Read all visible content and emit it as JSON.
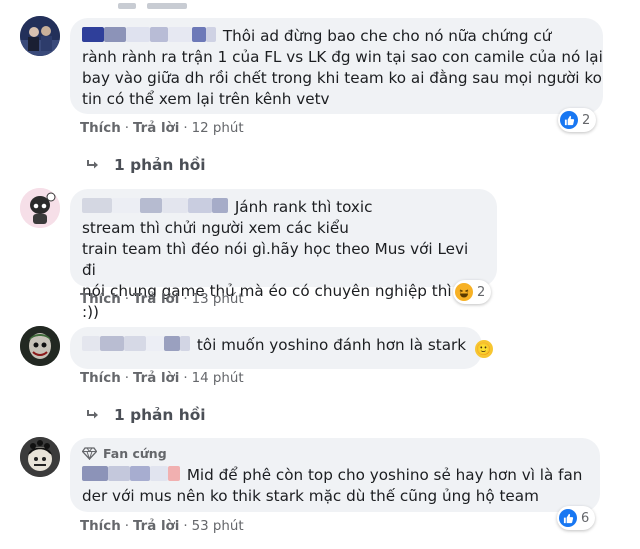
{
  "comments": [
    {
      "text": "Thôi ad đừng bao che cho nó nữa chứng cứ rành rành ra trận 1 của FL vs LK đg win tại sao con camile của nó lại bay vào giữa dh rồi chết trong khi team ko ai đằng sau mọi người ko tin có thể xem lại trên kênh vetv",
      "line1": "Thôi ad đừng bao che cho nó nữa chứng cứ",
      "line2": "rành rành ra trận 1 của FL vs LK đg win tại sao con camile của nó lại",
      "line3": "bay vào giữa dh rồi chết trong khi team ko ai đằng sau mọi người ko",
      "line4": "tin có thể xem lại trên kênh vetv",
      "like": "Thích",
      "reply": "Trả lời",
      "time": "12 phút",
      "reaction_icon": "like-icon",
      "reaction_count": "2"
    },
    {
      "line1": "Jánh rank thì toxic",
      "line2": "stream thì chửi người xem các kiểu",
      "line3": "train team thì đéo nói gì.hãy học theo Mus với Levi đi",
      "line4": "nói chung game thủ mà éo có chuyên nghiệp thì vứt :))",
      "like": "Thích",
      "reply": "Trả lời",
      "time": "13 phút",
      "reaction_icon": "haha-icon",
      "reaction_count": "2"
    },
    {
      "line1": "tôi muốn yoshino đánh hơn là stark",
      "emoji": "🙂",
      "like": "Thích",
      "reply": "Trả lời",
      "time": "14 phút"
    },
    {
      "badge": "Fan cứng",
      "line1": "Mid để phê còn top cho yoshino sẻ hay hơn vì là fan",
      "line2": "der với mus nên ko thik stark mặc dù thế cũng ủng hộ team",
      "like": "Thích",
      "reply": "Trả lời",
      "time": "53 phút",
      "reaction_icon": "like-icon",
      "reaction_count": "6"
    }
  ],
  "replies_link_1": "1 phản hồi",
  "replies_link_2": "1 phản hồi",
  "colors": {
    "bubble": "#f0f2f5",
    "meta": "#65676b",
    "like_blue": "#1877f2",
    "haha_yellow": "#f7b125"
  }
}
